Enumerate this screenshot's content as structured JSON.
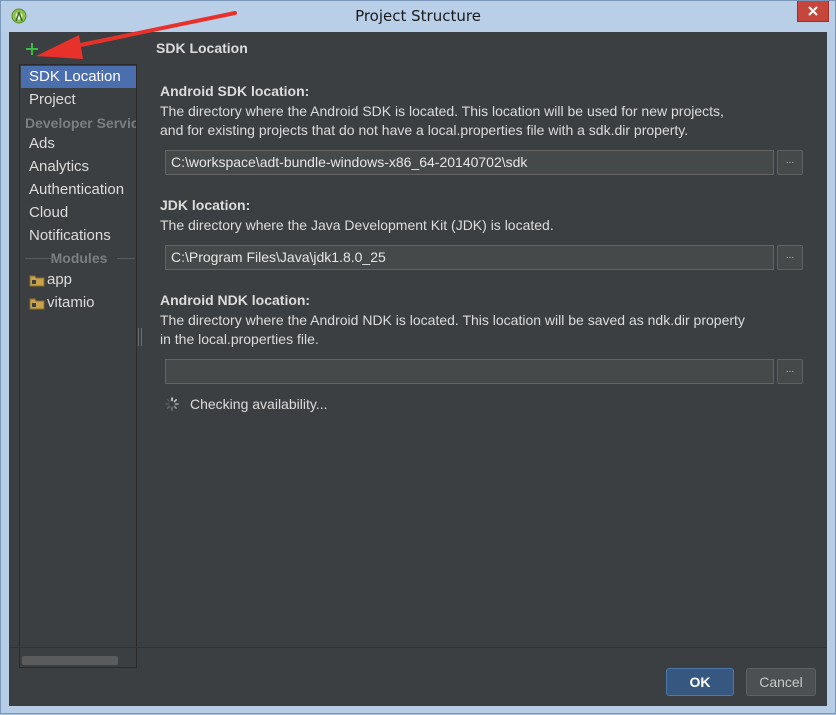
{
  "window": {
    "title": "Project Structure"
  },
  "sidebar": {
    "items": [
      {
        "label": "SDK Location"
      },
      {
        "label": "Project"
      }
    ],
    "developer_header": "Developer Servic",
    "developer_items": [
      {
        "label": "Ads"
      },
      {
        "label": "Analytics"
      },
      {
        "label": "Authentication"
      },
      {
        "label": "Cloud"
      },
      {
        "label": "Notifications"
      }
    ],
    "modules_header": "Modules",
    "modules": [
      {
        "label": "app"
      },
      {
        "label": "vitamio"
      }
    ]
  },
  "main": {
    "heading": "SDK Location",
    "sdk": {
      "label": "Android SDK location:",
      "description_line1": "The directory where the Android SDK is located. This location will be used for new projects,",
      "description_line2": "and for existing projects that do not have a local.properties file with a sdk.dir property.",
      "path": "C:\\workspace\\adt-bundle-windows-x86_64-20140702\\sdk",
      "browse": "..."
    },
    "jdk": {
      "label": "JDK location:",
      "description": "The directory where the Java Development Kit (JDK) is located.",
      "path": "C:\\Program Files\\Java\\jdk1.8.0_25",
      "browse": "..."
    },
    "ndk": {
      "label": "Android NDK location:",
      "description_line1": "The directory where the Android NDK is located. This location will be saved as ndk.dir property",
      "description_line2": "in the local.properties file.",
      "path": "",
      "browse": "...",
      "status": "Checking availability..."
    }
  },
  "footer": {
    "ok": "OK",
    "cancel": "Cancel"
  },
  "colors": {
    "accent": "#4b6eaf",
    "annotation_arrow": "#e8312a",
    "add_icon": "#3dbb47"
  }
}
